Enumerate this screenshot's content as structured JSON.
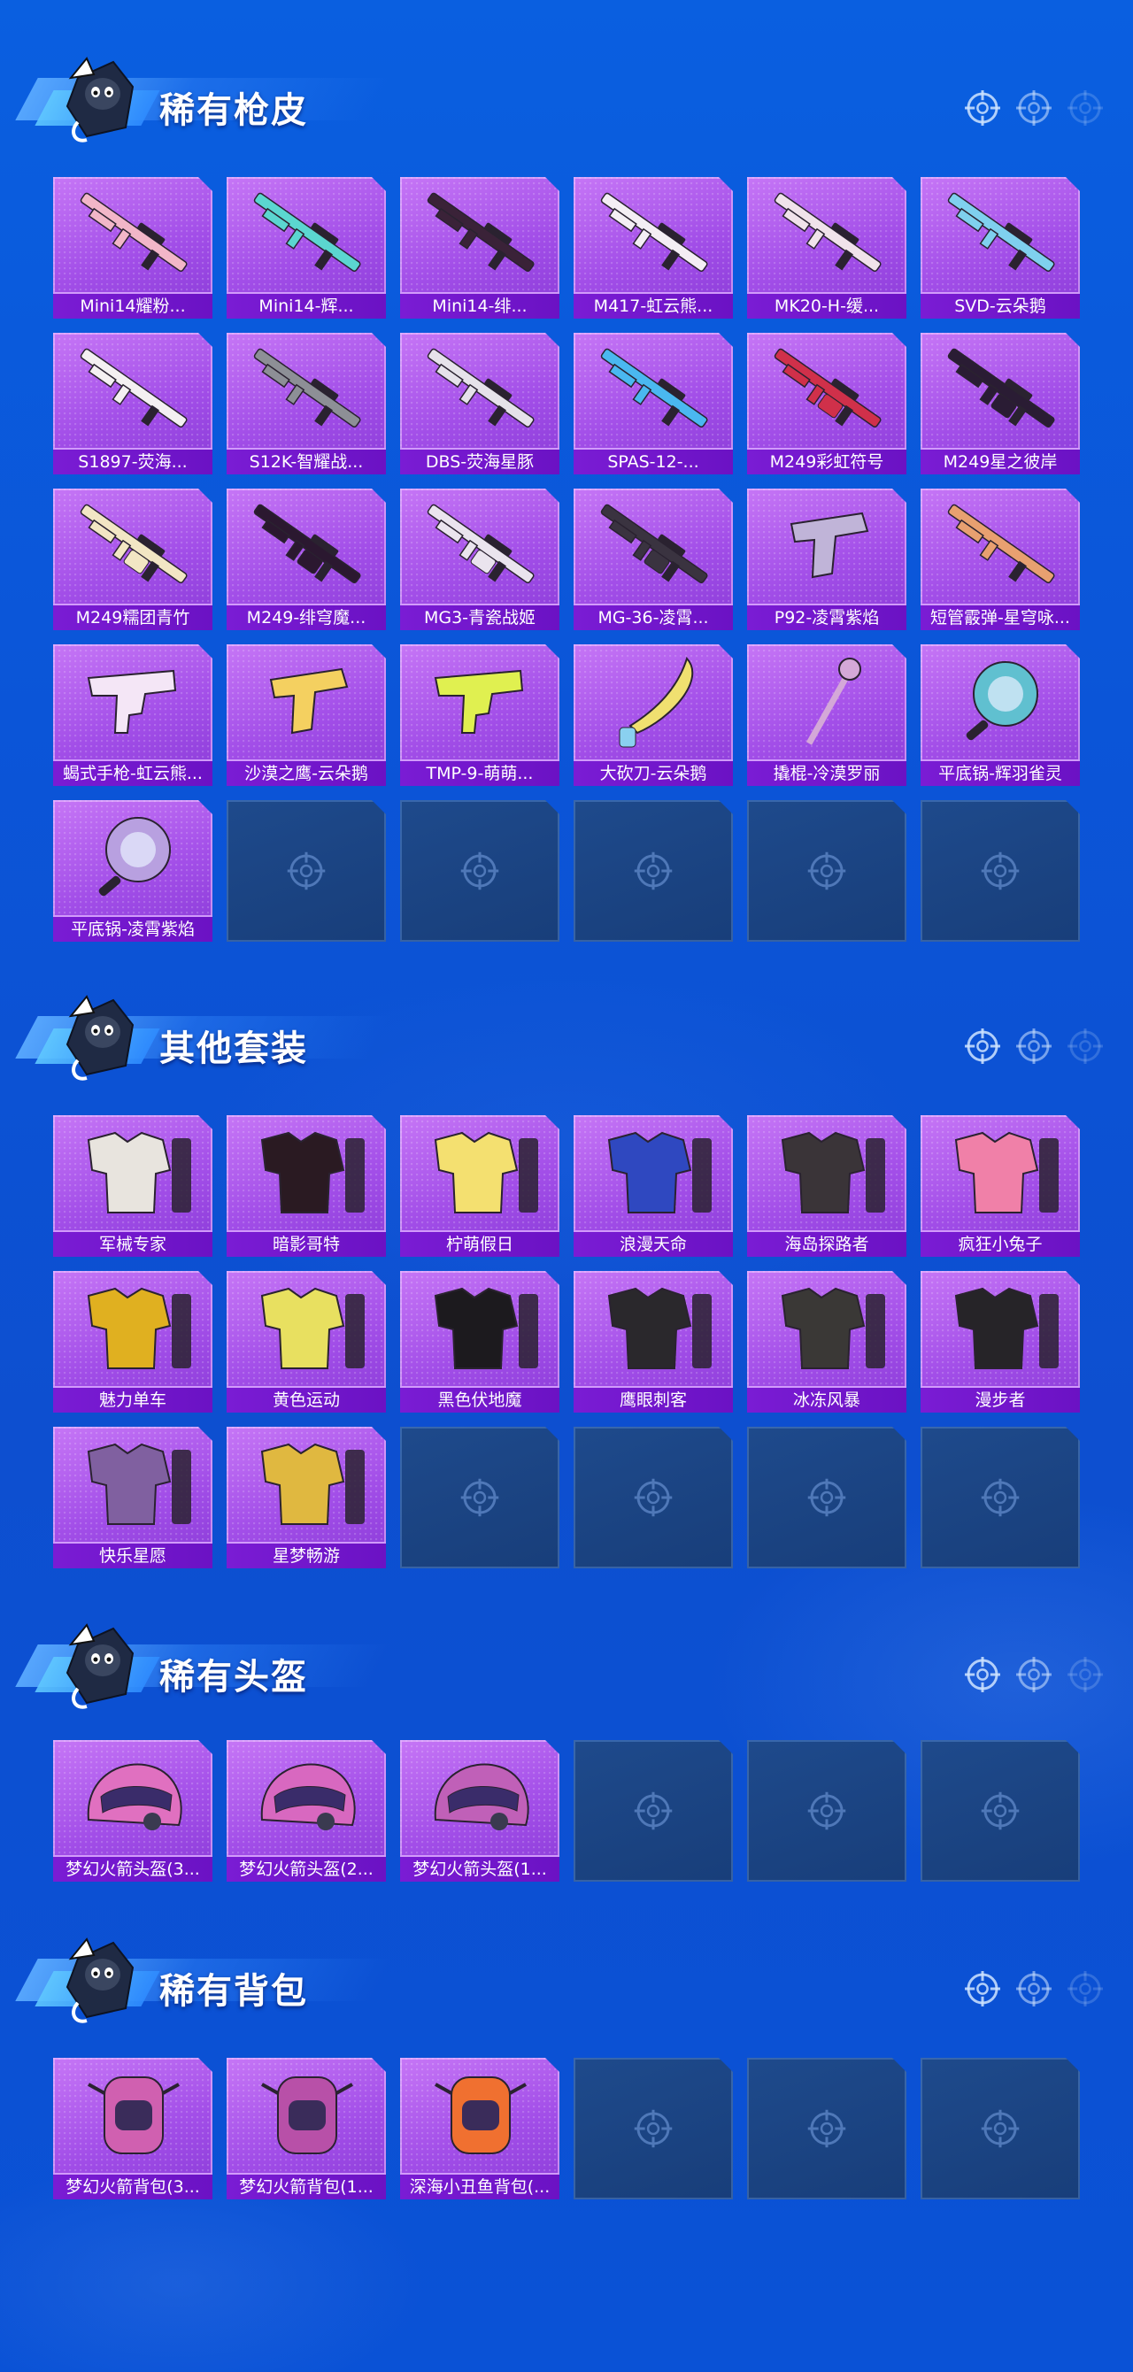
{
  "sections": [
    {
      "title": "稀有枪皮",
      "items": [
        {
          "label": "Mini14耀粉...",
          "kind": "rifle",
          "color": "#f2b6c8"
        },
        {
          "label": "Mini14-辉...",
          "kind": "rifle",
          "color": "#5bd6d0"
        },
        {
          "label": "Mini14-绯...",
          "kind": "rifle",
          "color": "#3a2238"
        },
        {
          "label": "M417-虹云熊...",
          "kind": "assault",
          "color": "#f4eef4"
        },
        {
          "label": "MK20-H-缓...",
          "kind": "rifle",
          "color": "#f0e2ea"
        },
        {
          "label": "SVD-云朵鹅",
          "kind": "rifle",
          "color": "#7fd0ee"
        },
        {
          "label": "S1897-荧海...",
          "kind": "shotgun",
          "color": "#f4f0f2"
        },
        {
          "label": "S12K-智耀战...",
          "kind": "assault",
          "color": "#8d8f96"
        },
        {
          "label": "DBS-荧海星豚",
          "kind": "assault",
          "color": "#e6e2ea"
        },
        {
          "label": "SPAS-12-...",
          "kind": "rifle",
          "color": "#4ab8f0"
        },
        {
          "label": "M249彩虹符号",
          "kind": "lmg",
          "color": "#d0304a"
        },
        {
          "label": "M249星之彼岸",
          "kind": "lmg",
          "color": "#2a1c34"
        },
        {
          "label": "M249糯团青竹",
          "kind": "lmg",
          "color": "#f2e6c4"
        },
        {
          "label": "M249-绯穹魔...",
          "kind": "lmg",
          "color": "#2b1830"
        },
        {
          "label": "MG3-青瓷战姬",
          "kind": "lmg",
          "color": "#eae4ee"
        },
        {
          "label": "MG-36-凌霄...",
          "kind": "lmg",
          "color": "#3a3340"
        },
        {
          "label": "P92-凌霄紫焰",
          "kind": "pistol",
          "color": "#c0b4d8"
        },
        {
          "label": "短管霰弹-星穹咏...",
          "kind": "shotgun",
          "color": "#e8a070"
        },
        {
          "label": "蝎式手枪-虹云熊...",
          "kind": "smg",
          "color": "#f4e6f6"
        },
        {
          "label": "沙漠之鹰-云朵鹅",
          "kind": "pistol",
          "color": "#f4d060"
        },
        {
          "label": "TMP-9-萌萌...",
          "kind": "smg",
          "color": "#e0f050"
        },
        {
          "label": "大砍刀-云朵鹅",
          "kind": "blade",
          "color": "#f0e070"
        },
        {
          "label": "撬棍-冷漠罗丽",
          "kind": "staff",
          "color": "#d4a8d8"
        },
        {
          "label": "平底锅-辉羽雀灵",
          "kind": "pan",
          "color": "#60c0d0"
        },
        {
          "label": "平底锅-凌霄紫焰",
          "kind": "pan",
          "color": "#b8a0e0"
        },
        {
          "label": "",
          "kind": "empty"
        },
        {
          "label": "",
          "kind": "empty"
        },
        {
          "label": "",
          "kind": "empty"
        },
        {
          "label": "",
          "kind": "empty"
        },
        {
          "label": "",
          "kind": "empty"
        }
      ]
    },
    {
      "title": "其他套装",
      "items": [
        {
          "label": "军械专家",
          "kind": "outfit",
          "color": "#e8e4de"
        },
        {
          "label": "暗影哥特",
          "kind": "outfit",
          "color": "#2a1a22"
        },
        {
          "label": "柠萌假日",
          "kind": "outfit",
          "color": "#f4e070"
        },
        {
          "label": "浪漫天命",
          "kind": "outfit",
          "color": "#2f48c0"
        },
        {
          "label": "海岛探路者",
          "kind": "outfit",
          "color": "#3a3438"
        },
        {
          "label": "疯狂小兔子",
          "kind": "outfit",
          "color": "#f080a8"
        },
        {
          "label": "魅力单车",
          "kind": "outfit",
          "color": "#e0b020"
        },
        {
          "label": "黄色运动",
          "kind": "outfit",
          "color": "#e8e060"
        },
        {
          "label": "黑色伏地魔",
          "kind": "outfit",
          "color": "#1c1a1e"
        },
        {
          "label": "鹰眼刺客",
          "kind": "outfit",
          "color": "#2a282c"
        },
        {
          "label": "冰冻风暴",
          "kind": "outfit",
          "color": "#3a3836"
        },
        {
          "label": "漫步者",
          "kind": "outfit",
          "color": "#262428"
        },
        {
          "label": "快乐星愿",
          "kind": "outfit",
          "color": "#8060a0"
        },
        {
          "label": "星梦畅游",
          "kind": "outfit",
          "color": "#e0b840"
        },
        {
          "label": "",
          "kind": "empty"
        },
        {
          "label": "",
          "kind": "empty"
        },
        {
          "label": "",
          "kind": "empty"
        },
        {
          "label": "",
          "kind": "empty"
        }
      ]
    },
    {
      "title": "稀有头盔",
      "items": [
        {
          "label": "梦幻火箭头盔(3...",
          "kind": "helmet",
          "color": "#e070c0"
        },
        {
          "label": "梦幻火箭头盔(2...",
          "kind": "helmet",
          "color": "#d868c0"
        },
        {
          "label": "梦幻火箭头盔(1...",
          "kind": "helmet",
          "color": "#c060b8"
        },
        {
          "label": "",
          "kind": "empty"
        },
        {
          "label": "",
          "kind": "empty"
        },
        {
          "label": "",
          "kind": "empty"
        }
      ]
    },
    {
      "title": "稀有背包",
      "items": [
        {
          "label": "梦幻火箭背包(3...",
          "kind": "backpack",
          "color": "#d060b0"
        },
        {
          "label": "梦幻火箭背包(1...",
          "kind": "backpack",
          "color": "#b850a8"
        },
        {
          "label": "深海小丑鱼背包(...",
          "kind": "backpack",
          "color": "#f07030"
        },
        {
          "label": "",
          "kind": "empty"
        },
        {
          "label": "",
          "kind": "empty"
        },
        {
          "label": "",
          "kind": "empty"
        }
      ]
    }
  ]
}
